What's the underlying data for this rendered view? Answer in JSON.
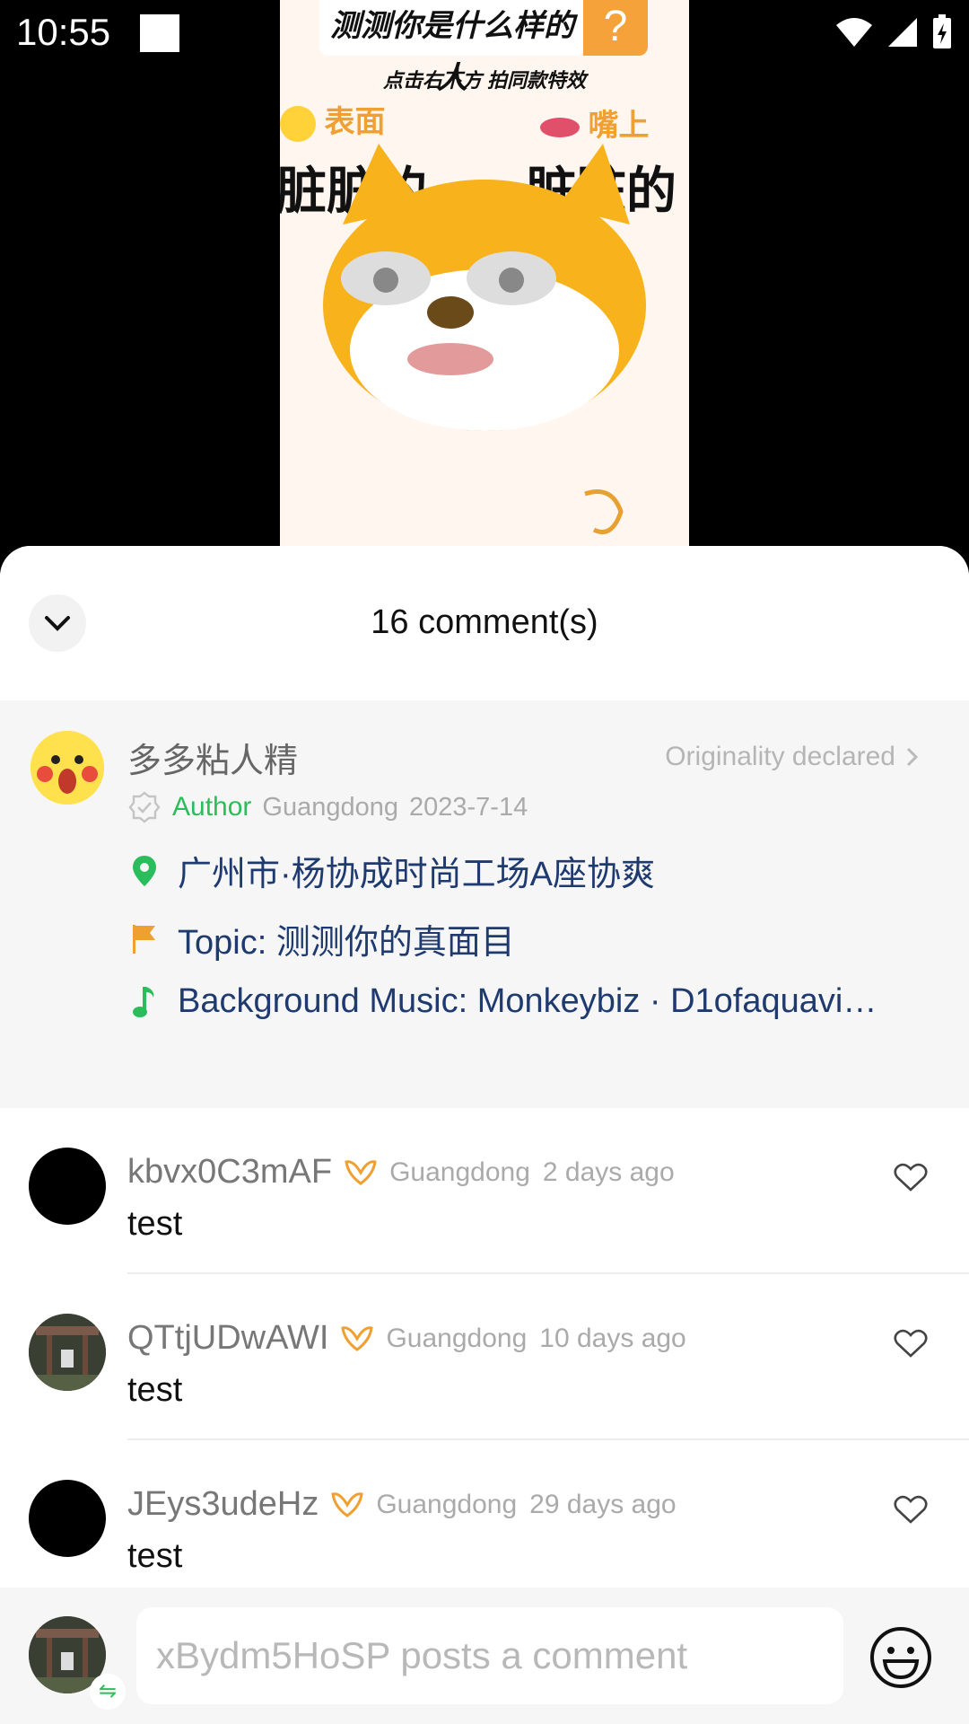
{
  "status": {
    "time": "10:55"
  },
  "video": {
    "title": "测测你是什么样的人",
    "question_mark": "?",
    "subtitle": "点击右下方 拍同款特效",
    "label_left": "表面",
    "label_right": "嘴上",
    "big_left": "脏脏的",
    "big_right": "脏脏的"
  },
  "sheet": {
    "title": "16 comment(s)",
    "author": {
      "name": "多多粘人精",
      "originality": "Originality declared",
      "tag": "Author",
      "region": "Guangdong",
      "date": "2023-7-14",
      "location": "广州市·杨协成时尚工场A座协爽",
      "topic": "Topic: 测测你的真面目",
      "music": "Background Music: Monkeybiz · D1ofaquavi…"
    },
    "comments": [
      {
        "user": "kbvx0C3mAF",
        "region": "Guangdong",
        "time": "2 days ago",
        "text": "test"
      },
      {
        "user": "QTtjUDwAWI",
        "region": "Guangdong",
        "time": "10 days ago",
        "text": "test"
      },
      {
        "user": "JEys3udeHz",
        "region": "Guangdong",
        "time": "29 days ago",
        "text": "test"
      }
    ]
  },
  "input": {
    "placeholder": "xBydm5HoSP posts a comment"
  },
  "colors": {
    "accent_green": "#2bbd5c",
    "link_blue": "#1e3a6e",
    "orange": "#f0a030"
  },
  "icons": [
    "collapse-chevron-icon",
    "verified-icon",
    "location-pin-icon",
    "topic-flag-icon",
    "music-note-icon",
    "badge-icon",
    "heart-icon",
    "emoji-icon"
  ]
}
